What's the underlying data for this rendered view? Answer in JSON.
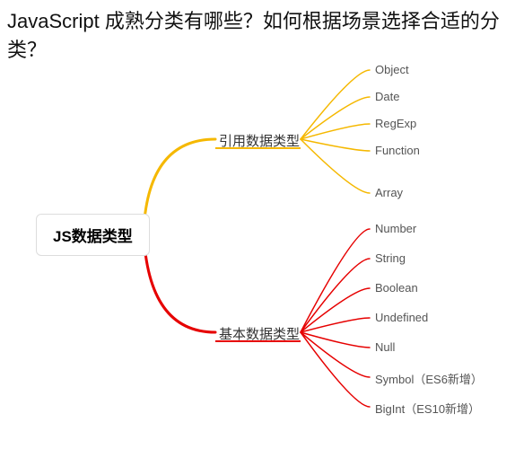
{
  "heading": "JavaScript 成熟分类有哪些？如何根据场景选择合适的分类？",
  "root": {
    "label": "JS数据类型"
  },
  "branches": {
    "reference": {
      "label": "引用数据类型",
      "color": "#f5b800",
      "items": [
        "Object",
        "Date",
        "RegExp",
        "Function",
        "Array"
      ]
    },
    "primitive": {
      "label": "基本数据类型",
      "color": "#e60000",
      "items": [
        "Number",
        "String",
        "Boolean",
        "Undefined",
        "Null",
        "Symbol（ES6新增）",
        "BigInt（ES10新增）"
      ]
    }
  }
}
